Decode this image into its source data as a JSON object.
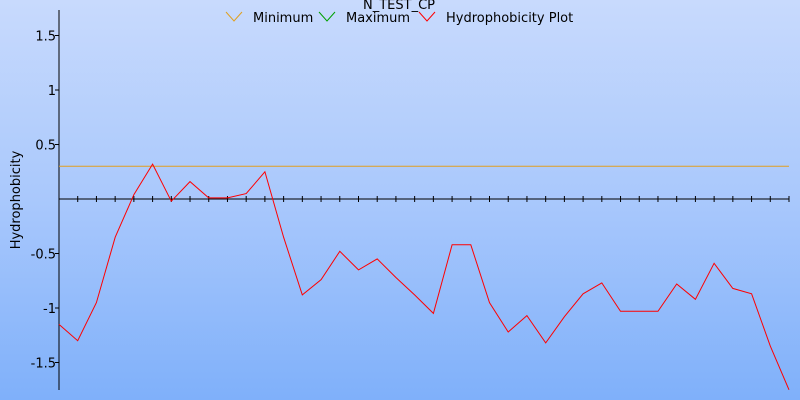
{
  "chart_data": {
    "type": "line",
    "title": "N_TEST_CP",
    "ylabel": "Hydrophobicity",
    "xlabel": "",
    "ylim": [
      -1.75,
      1.75
    ],
    "y_ticks": [
      {
        "value": 1.5,
        "label": "1.5"
      },
      {
        "value": 1,
        "label": "1"
      },
      {
        "value": 0.5,
        "label": "0.5"
      },
      {
        "value": -0.5,
        "label": "-0.5"
      },
      {
        "value": -1,
        "label": "-1"
      },
      {
        "value": -1.5,
        "label": "-1.5"
      }
    ],
    "x_count": 40,
    "legend": {
      "position": "top-center",
      "entries": [
        {
          "name": "Minimum",
          "color": "#e0a020"
        },
        {
          "name": "Maximum",
          "color": "#00a000"
        },
        {
          "name": "Hydrophobicity Plot",
          "color": "#ff0000"
        }
      ]
    },
    "series": [
      {
        "name": "Minimum",
        "color": "#e0a020",
        "constant": 0.3
      },
      {
        "name": "Maximum",
        "color": "#00a000",
        "values": []
      },
      {
        "name": "Hydrophobicity Plot",
        "color": "#ff0000",
        "values": [
          -1.15,
          -1.3,
          -0.95,
          -0.35,
          0.04,
          0.32,
          -0.02,
          0.16,
          0.01,
          0.01,
          0.05,
          0.25,
          -0.35,
          -0.88,
          -0.74,
          -0.48,
          -0.65,
          -0.55,
          -0.72,
          -0.88,
          -1.05,
          -0.42,
          -0.42,
          -0.95,
          -1.22,
          -1.07,
          -1.32,
          -1.08,
          -0.87,
          -0.77,
          -1.03,
          -1.03,
          -1.03,
          -0.78,
          -0.92,
          -0.59,
          -0.82,
          -0.87,
          -1.35,
          -1.75
        ]
      }
    ],
    "grid": false
  }
}
